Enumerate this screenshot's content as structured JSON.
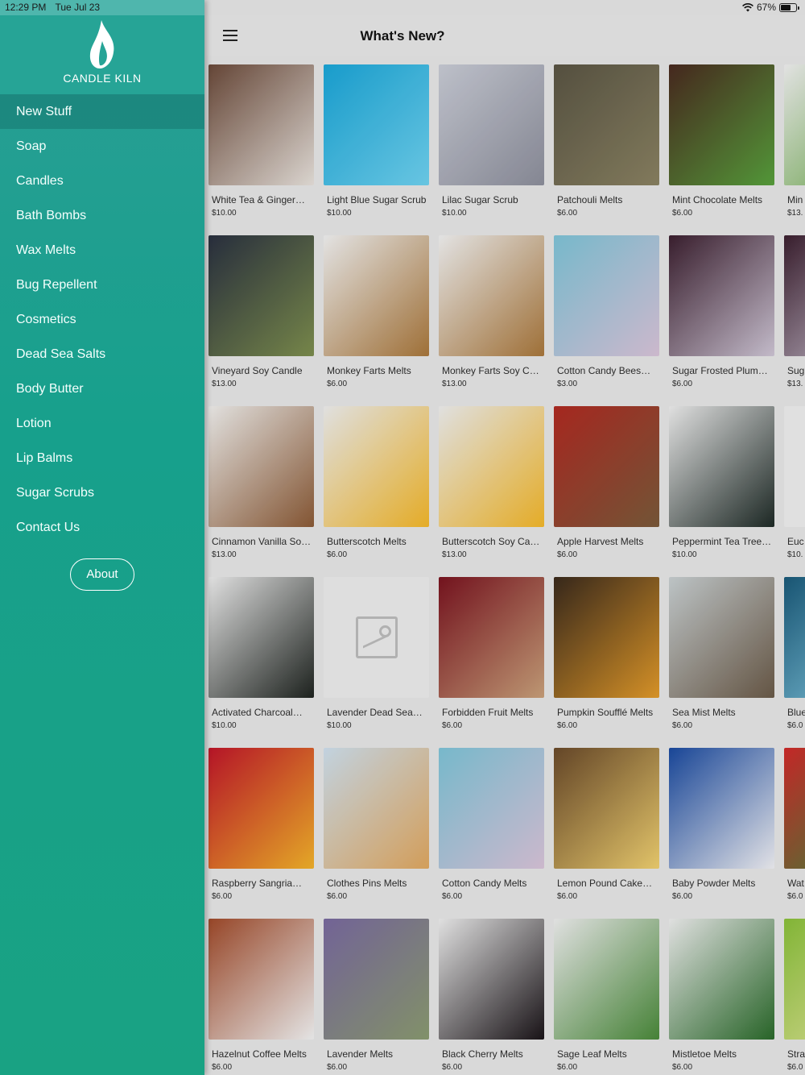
{
  "status": {
    "time": "12:29 PM",
    "date": "Tue Jul 23",
    "battery": "67%"
  },
  "sidebar": {
    "brand": "CANDLE KILN",
    "items": [
      {
        "label": "New Stuff"
      },
      {
        "label": "Soap"
      },
      {
        "label": "Candles"
      },
      {
        "label": "Bath Bombs"
      },
      {
        "label": "Wax Melts"
      },
      {
        "label": "Bug Repellent"
      },
      {
        "label": "Cosmetics"
      },
      {
        "label": "Dead Sea Salts"
      },
      {
        "label": "Body Butter"
      },
      {
        "label": "Lotion"
      },
      {
        "label": "Lip Balms"
      },
      {
        "label": "Sugar Scrubs"
      },
      {
        "label": "Contact Us"
      }
    ],
    "about_label": "About"
  },
  "header": {
    "title": "What's New?"
  },
  "products": [
    [
      {
        "name": "White Tea & Ginger…",
        "price": "$10.00",
        "c1": "#6b4a3a",
        "c2": "#e8e2dc"
      },
      {
        "name": "Light Blue Sugar Scrub",
        "price": "$10.00",
        "c1": "#1aa6d8",
        "c2": "#6fd2f0"
      },
      {
        "name": "Lilac Sugar Scrub",
        "price": "$10.00",
        "c1": "#c9ccd6",
        "c2": "#8d8f9c"
      },
      {
        "name": "Patchouli Melts",
        "price": "$6.00",
        "c1": "#5a5544",
        "c2": "#8a8262"
      },
      {
        "name": "Mint Chocolate Melts",
        "price": "$6.00",
        "c1": "#4a2a20",
        "c2": "#58a03c"
      },
      {
        "name": "Min",
        "price": "$13.",
        "c1": "#f0f0f0",
        "c2": "#6aa848"
      }
    ],
    [
      {
        "name": "Vineyard Soy Candle",
        "price": "$13.00",
        "c1": "#2a3140",
        "c2": "#7d8e4e"
      },
      {
        "name": "Monkey Farts Melts",
        "price": "$6.00",
        "c1": "#f1f1f1",
        "c2": "#a9773b"
      },
      {
        "name": "Monkey Farts Soy C…",
        "price": "$13.00",
        "c1": "#f1f1f1",
        "c2": "#a9773b"
      },
      {
        "name": "Cotton Candy Bees…",
        "price": "$3.00",
        "c1": "#7fc4d8",
        "c2": "#d9c4d9"
      },
      {
        "name": "Sugar Frosted Plum…",
        "price": "$6.00",
        "c1": "#3c2030",
        "c2": "#cfc6d6"
      },
      {
        "name": "Sug",
        "price": "$13.",
        "c1": "#3c2030",
        "c2": "#cfc6d6"
      }
    ],
    [
      {
        "name": "Cinnamon Vanilla So…",
        "price": "$13.00",
        "c1": "#f0efed",
        "c2": "#8b5a36"
      },
      {
        "name": "Butterscotch Melts",
        "price": "$6.00",
        "c1": "#eeeeee",
        "c2": "#f3b72a"
      },
      {
        "name": "Butterscotch Soy Ca…",
        "price": "$13.00",
        "c1": "#eeeeee",
        "c2": "#f3b72a"
      },
      {
        "name": "Apple Harvest Melts",
        "price": "$6.00",
        "c1": "#b02a22",
        "c2": "#7a5a3a"
      },
      {
        "name": "Peppermint Tea Tree…",
        "price": "$10.00",
        "c1": "#eeeeee",
        "c2": "#1e2a26"
      },
      {
        "name": "Euc",
        "price": "$10.",
        "c1": "#eeeeee",
        "c2": "#eeeeee"
      }
    ],
    [
      {
        "name": "Activated Charcoal…",
        "price": "$10.00",
        "c1": "#eeeeee",
        "c2": "#1f2420"
      },
      {
        "name": "Lavender Dead Sea…",
        "price": "$10.00",
        "c1": "#ececec",
        "c2": "#ececec"
      },
      {
        "name": "Forbidden Fruit Melts",
        "price": "$6.00",
        "c1": "#7a1420",
        "c2": "#c9a07a"
      },
      {
        "name": "Pumpkin Soufflé Melts",
        "price": "$6.00",
        "c1": "#3a2a1c",
        "c2": "#e29a2a"
      },
      {
        "name": "Sea Mist Melts",
        "price": "$6.00",
        "c1": "#c9d0d2",
        "c2": "#6a5a48"
      },
      {
        "name": "Blue",
        "price": "$6.0",
        "c1": "#1a5a7a",
        "c2": "#8ad0e8"
      }
    ],
    [
      {
        "name": "Raspberry Sangria…",
        "price": "$6.00",
        "c1": "#c0162a",
        "c2": "#f2b22a"
      },
      {
        "name": "Clothes Pins Melts",
        "price": "$6.00",
        "c1": "#cfe0ee",
        "c2": "#e0a860"
      },
      {
        "name": "Cotton Candy Melts",
        "price": "$6.00",
        "c1": "#7fc4d8",
        "c2": "#d9c4d9"
      },
      {
        "name": "Lemon Pound Cake…",
        "price": "$6.00",
        "c1": "#6a4a2a",
        "c2": "#f0d070"
      },
      {
        "name": "Baby Powder Melts",
        "price": "$6.00",
        "c1": "#1a4aa0",
        "c2": "#f0f0f4"
      },
      {
        "name": "Wat",
        "price": "$6.0",
        "c1": "#d02a2a",
        "c2": "#3a8a3a"
      }
    ],
    [
      {
        "name": "Hazelnut Coffee Melts",
        "price": "$6.00",
        "c1": "#a04a2a",
        "c2": "#f2f2f2"
      },
      {
        "name": "Lavender Melts",
        "price": "$6.00",
        "c1": "#7a6aa0",
        "c2": "#8a9a70"
      },
      {
        "name": "Black Cherry Melts",
        "price": "$6.00",
        "c1": "#eeeeee",
        "c2": "#1a1418"
      },
      {
        "name": "Sage Leaf Melts",
        "price": "$6.00",
        "c1": "#eeeeee",
        "c2": "#4a8a3a"
      },
      {
        "name": "Mistletoe Melts",
        "price": "$6.00",
        "c1": "#eeeeee",
        "c2": "#2a6a2a"
      },
      {
        "name": "Stra",
        "price": "$6.0",
        "c1": "#8ac03a",
        "c2": "#e8e8a0"
      }
    ]
  ]
}
